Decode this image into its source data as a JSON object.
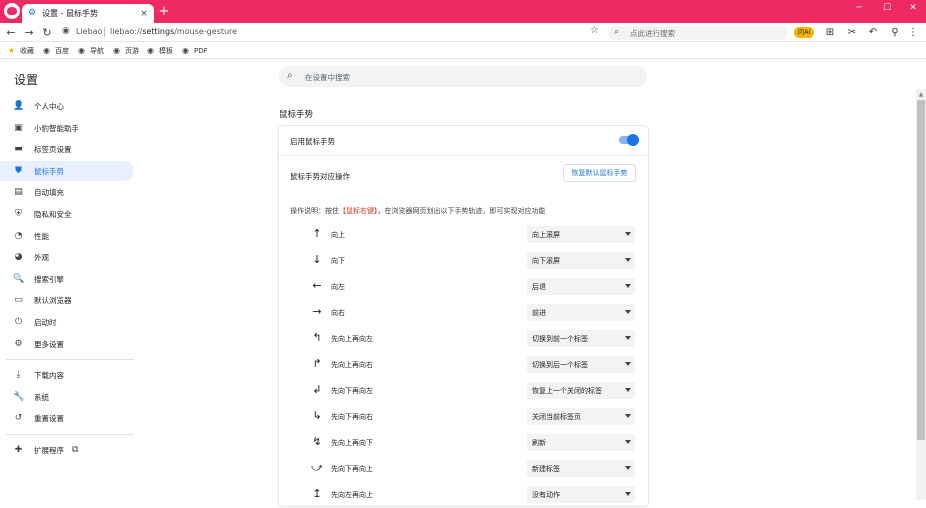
{
  "window": {
    "tab_title": "设置 - 鼠标手势",
    "tab_close": "×",
    "new_tab": "+",
    "controls": {
      "minimize": "─",
      "maximize": "☐",
      "close": "✕"
    }
  },
  "addressbar": {
    "site": "Liebao",
    "url_prefix": "liebao://",
    "url_host": "settings",
    "url_path": "/mouse-gesture",
    "search_placeholder": "点此进行搜索",
    "ai_badge": "问AI"
  },
  "bookmarks": [
    {
      "label": "收藏",
      "icon": "★"
    },
    {
      "label": "百度",
      "icon": "◉"
    },
    {
      "label": "导航",
      "icon": "◉"
    },
    {
      "label": "页游",
      "icon": "◉"
    },
    {
      "label": "模板",
      "icon": "◉"
    },
    {
      "label": "PDF",
      "icon": "◉"
    }
  ],
  "sidebar": {
    "title": "设置",
    "items": [
      {
        "label": "个人中心",
        "icon": "👤"
      },
      {
        "label": "小豹智能助手",
        "icon": "▣"
      },
      {
        "label": "标签页设置",
        "icon": "▬"
      },
      {
        "label": "鼠标手势",
        "icon": "⛊"
      },
      {
        "label": "自动填充",
        "icon": "▤"
      },
      {
        "label": "隐私和安全",
        "icon": "⛨"
      },
      {
        "label": "性能",
        "icon": "◔"
      },
      {
        "label": "外观",
        "icon": "◕"
      },
      {
        "label": "搜索引擎",
        "icon": "🔍"
      },
      {
        "label": "默认浏览器",
        "icon": "▭"
      },
      {
        "label": "启动时",
        "icon": "⏻"
      },
      {
        "label": "更多设置",
        "icon": "⚙"
      },
      {
        "label": "下载内容",
        "icon": "⤓"
      },
      {
        "label": "系统",
        "icon": "🔧"
      },
      {
        "label": "重置设置",
        "icon": "↺"
      },
      {
        "label": "扩展程序",
        "icon": "✚"
      }
    ],
    "active_index": 3
  },
  "main": {
    "search_placeholder": "在设置中搜索",
    "section_title": "鼠标手势",
    "enable_label": "启用鼠标手势",
    "enabled": true,
    "ops_label": "鼠标手势对应操作",
    "restore_button": "恢复默认鼠标手势",
    "instr_pre": "操作说明：按住",
    "instr_hl": "【鼠标右键】",
    "instr_post": "，在浏览器网页划出以下手势轨迹，即可实现对应功能",
    "gestures": [
      {
        "arrow": "↑",
        "name": "向上",
        "action": "向上滚屏"
      },
      {
        "arrow": "↓",
        "name": "向下",
        "action": "向下滚屏"
      },
      {
        "arrow": "←",
        "name": "向左",
        "action": "后退"
      },
      {
        "arrow": "→",
        "name": "向右",
        "action": "前进"
      },
      {
        "arrow": "↰",
        "name": "先向上再向左",
        "action": "切换到前一个标签"
      },
      {
        "arrow": "↱",
        "name": "先向上再向右",
        "action": "切换到后一个标签"
      },
      {
        "arrow": "↲",
        "name": "先向下再向左",
        "action": "恢复上一个关闭的标签"
      },
      {
        "arrow": "↳",
        "name": "先向下再向右",
        "action": "关闭当前标签页"
      },
      {
        "arrow": "↯",
        "name": "先向上再向下",
        "action": "刷新"
      },
      {
        "arrow": "⤻",
        "name": "先向下再向上",
        "action": "新建标签"
      },
      {
        "arrow": "↥",
        "name": "先向左再向上",
        "action": "没有动作"
      }
    ]
  },
  "colors": {
    "accent": "#1a73e8",
    "brand": "#ee2a63",
    "highlight": "#d93025"
  }
}
